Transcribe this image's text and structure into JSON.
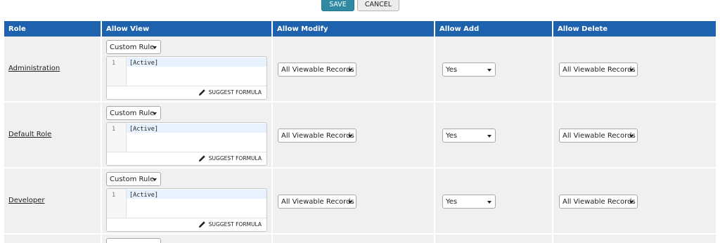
{
  "toolbar": {
    "save_label": "SAVE",
    "cancel_label": "CANCEL"
  },
  "table": {
    "headers": [
      "Role",
      "Allow View",
      "Allow Modify",
      "Allow Add",
      "Allow Delete"
    ],
    "rows": [
      {
        "role": "Administration",
        "view_rule": "Custom Rule",
        "formula_line_no": "1",
        "formula": "[Active]",
        "suggest_label": "SUGGEST FORMULA",
        "modify": "All Viewable Records",
        "add": "Yes",
        "delete": "All Viewable Records"
      },
      {
        "role": "Default Role",
        "view_rule": "Custom Rule",
        "formula_line_no": "1",
        "formula": "[Active]",
        "suggest_label": "SUGGEST FORMULA",
        "modify": "All Viewable Records",
        "add": "Yes",
        "delete": "All Viewable Records"
      },
      {
        "role": "Developer",
        "view_rule": "Custom Rule",
        "formula_line_no": "1",
        "formula": "[Active]",
        "suggest_label": "SUGGEST FORMULA",
        "modify": "All Viewable Records",
        "add": "Yes",
        "delete": "All Viewable Records"
      }
    ]
  },
  "icons": {
    "suggest": "pencil-icon",
    "dropdown": "chevron-down-icon"
  },
  "colors": {
    "header_bg": "#1e62ad",
    "save_bg": "#2f8aa2",
    "row_bg": "#f0f0f0"
  }
}
